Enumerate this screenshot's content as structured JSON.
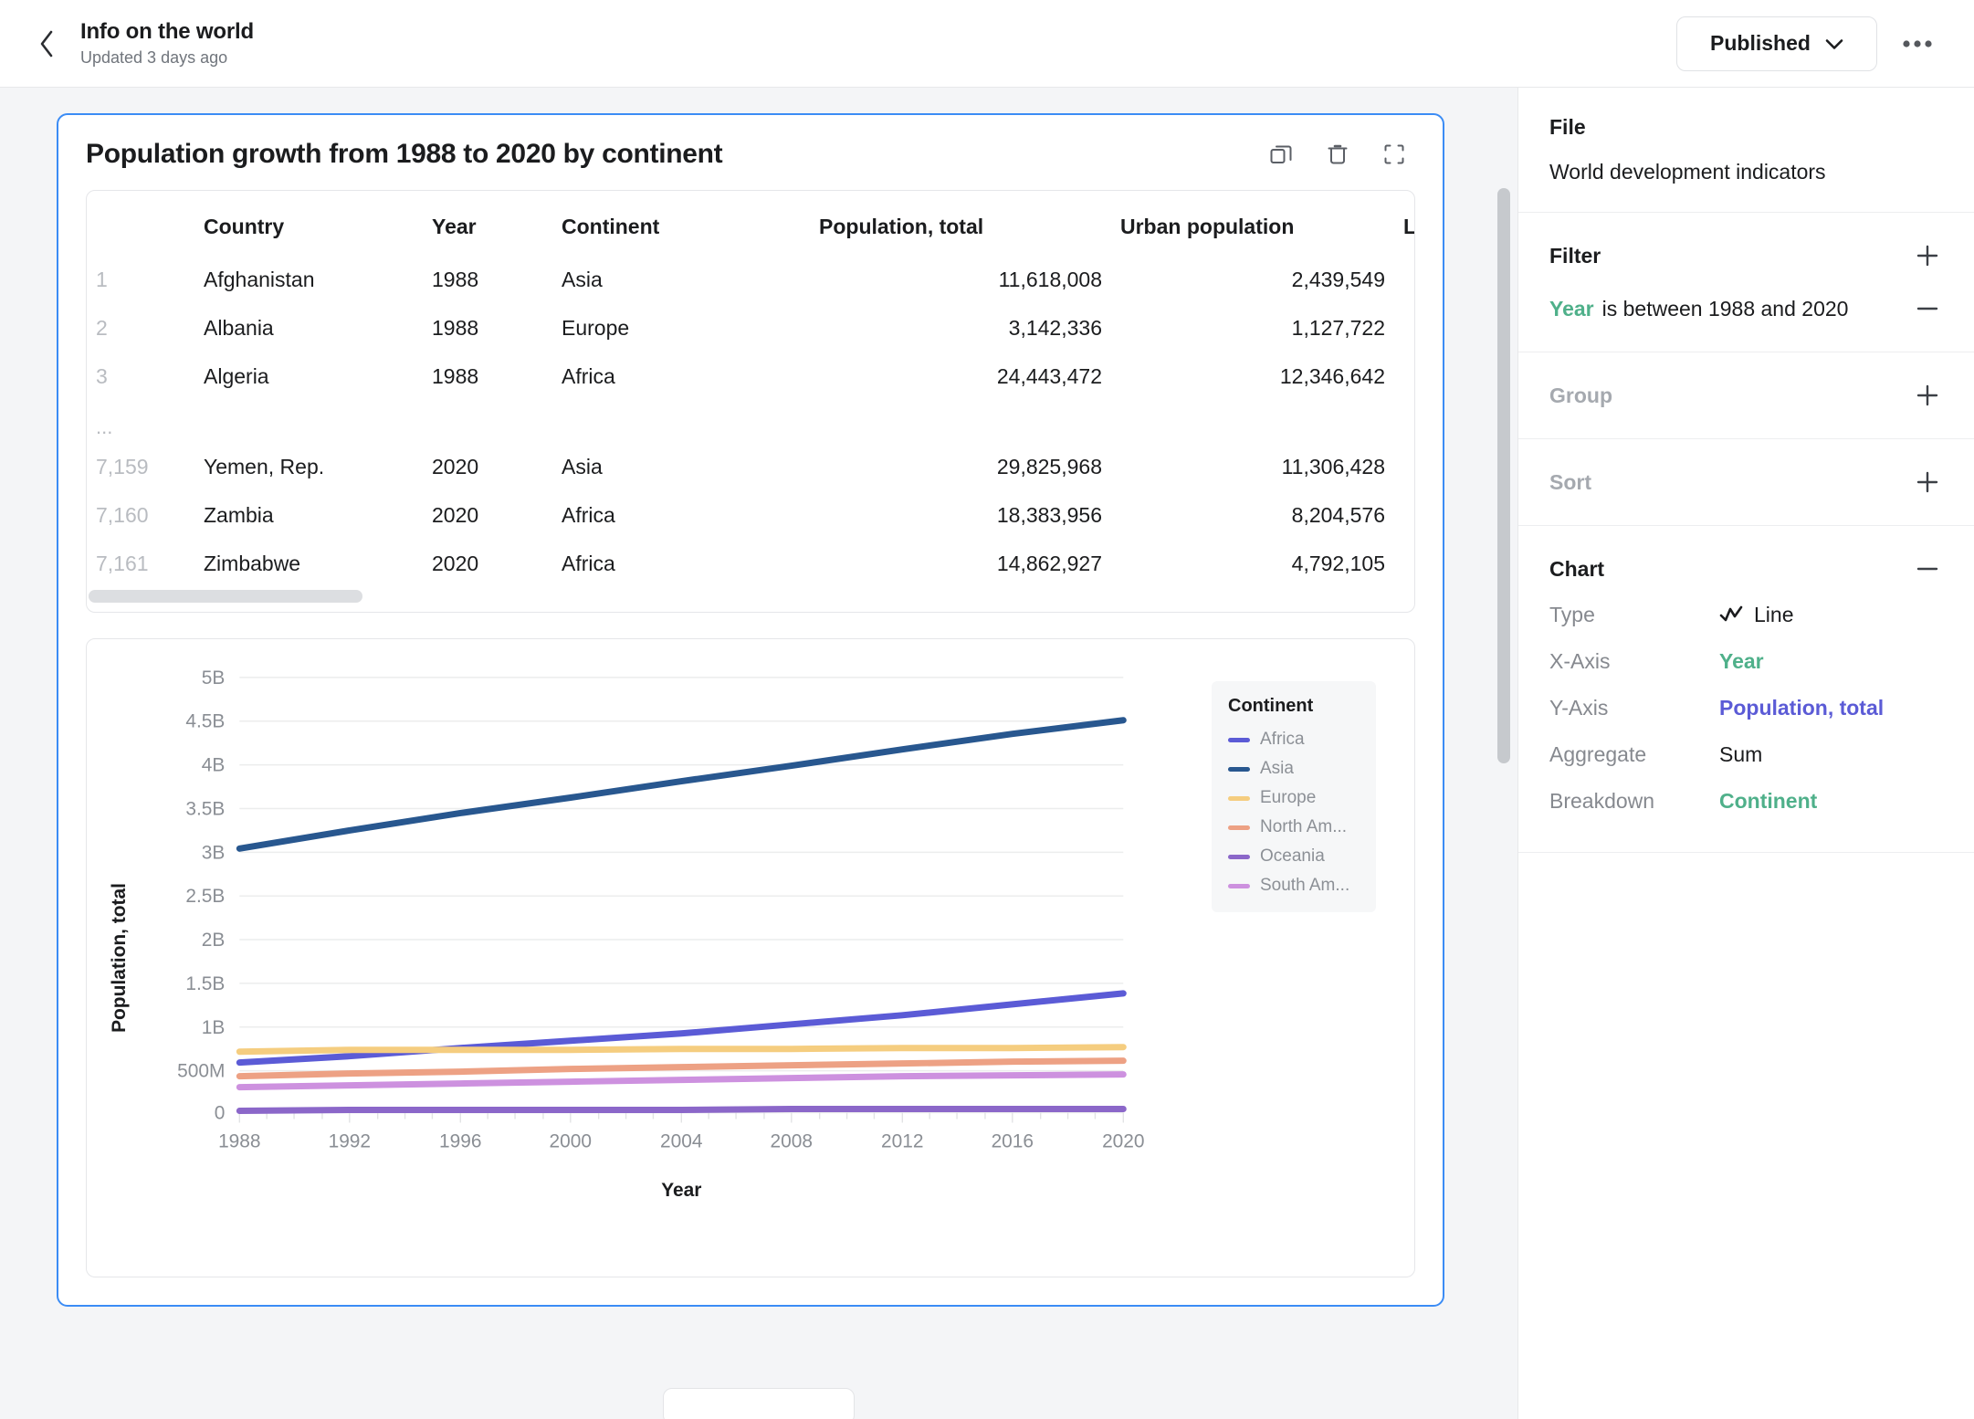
{
  "topbar": {
    "back_icon": "chevron-left-icon",
    "title": "Info on the world",
    "subtitle": "Updated 3 days ago",
    "published_label": "Published",
    "published_caret": "chevron-down-icon",
    "more_label": "•••"
  },
  "card": {
    "title": "Population growth from 1988 to 2020 by continent",
    "actions": [
      "duplicate-icon",
      "trash-icon",
      "expand-icon"
    ],
    "accent": "#3b8cf5"
  },
  "table": {
    "columns": [
      "",
      "Country",
      "Year",
      "Continent",
      "Population, total",
      "Urban population",
      "La"
    ],
    "rows": [
      {
        "idx": "1",
        "country": "Afghanistan",
        "year": "1988",
        "continent": "Asia",
        "population": "11,618,008",
        "urban": "2,439,549"
      },
      {
        "idx": "2",
        "country": "Albania",
        "year": "1988",
        "continent": "Europe",
        "population": "3,142,336",
        "urban": "1,127,722"
      },
      {
        "idx": "3",
        "country": "Algeria",
        "year": "1988",
        "continent": "Africa",
        "population": "24,443,472",
        "urban": "12,346,642"
      }
    ],
    "ellipsis": "...",
    "rows_tail": [
      {
        "idx": "7,159",
        "country": "Yemen, Rep.",
        "year": "2020",
        "continent": "Asia",
        "population": "29,825,968",
        "urban": "11,306,428"
      },
      {
        "idx": "7,160",
        "country": "Zambia",
        "year": "2020",
        "continent": "Africa",
        "population": "18,383,956",
        "urban": "8,204,576"
      },
      {
        "idx": "7,161",
        "country": "Zimbabwe",
        "year": "2020",
        "continent": "Africa",
        "population": "14,862,927",
        "urban": "4,792,105"
      }
    ]
  },
  "chart_data": {
    "type": "line",
    "title": "Population growth from 1988 to 2020 by continent",
    "xlabel": "Year",
    "ylabel": "Population, total",
    "legend_title": "Continent",
    "legend_position": "right-inside",
    "grid": true,
    "xlim": [
      1988,
      2020
    ],
    "ylim": [
      0,
      5000000000
    ],
    "xticks": [
      "1988",
      "1992",
      "1996",
      "2000",
      "2004",
      "2008",
      "2012",
      "2016",
      "2020"
    ],
    "yticks": [
      "0",
      "500M",
      "1B",
      "1.5B",
      "2B",
      "2.5B",
      "3B",
      "3.5B",
      "4B",
      "4.5B",
      "5B"
    ],
    "x": [
      1988,
      1992,
      1996,
      2000,
      2004,
      2008,
      2012,
      2016,
      2020
    ],
    "series": [
      {
        "name": "Africa",
        "color": "#5b5bd6",
        "values": [
          570000000,
          650000000,
          740000000,
          820000000,
          910000000,
          1010000000,
          1120000000,
          1240000000,
          1360000000
        ]
      },
      {
        "name": "Asia",
        "color": "#28578f",
        "values": [
          3020000000,
          3230000000,
          3430000000,
          3610000000,
          3790000000,
          3970000000,
          4150000000,
          4330000000,
          4490000000
        ]
      },
      {
        "name": "Europe",
        "color": "#f5cd7f",
        "values": [
          700000000,
          715000000,
          720000000,
          722000000,
          726000000,
          733000000,
          740000000,
          745000000,
          748000000
        ]
      },
      {
        "name": "North Am...",
        "color": "#eda184",
        "values": [
          420000000,
          445000000,
          470000000,
          495000000,
          518000000,
          540000000,
          562000000,
          582000000,
          598000000
        ]
      },
      {
        "name": "Oceania",
        "color": "#8b67c9",
        "values": [
          26000000,
          28000000,
          30000000,
          31500000,
          33500000,
          35500000,
          38000000,
          40500000,
          43000000
        ]
      },
      {
        "name": "South Am...",
        "color": "#cd91df",
        "values": [
          290000000,
          312000000,
          335000000,
          355000000,
          375000000,
          395000000,
          413000000,
          428000000,
          440000000
        ]
      }
    ]
  },
  "sidebar": {
    "file": {
      "heading": "File",
      "value": "World development indicators"
    },
    "filter": {
      "heading": "Filter",
      "add_icon": "plus-icon",
      "entries": [
        {
          "field": "Year",
          "rest": "is between 1988 and 2020",
          "remove_icon": "minus-icon"
        }
      ]
    },
    "group": {
      "heading": "Group",
      "add_icon": "plus-icon"
    },
    "sort": {
      "heading": "Sort",
      "add_icon": "plus-icon"
    },
    "chart": {
      "heading": "Chart",
      "collapse_icon": "minus-icon",
      "rows": [
        {
          "label": "Type",
          "value": "Line",
          "icon": "line-chart-icon",
          "style": "plain"
        },
        {
          "label": "X-Axis",
          "value": "Year",
          "style": "green"
        },
        {
          "label": "Y-Axis",
          "value": "Population, total",
          "style": "blue"
        },
        {
          "label": "Aggregate",
          "value": "Sum",
          "style": "plain"
        },
        {
          "label": "Breakdown",
          "value": "Continent",
          "style": "green"
        }
      ]
    }
  }
}
